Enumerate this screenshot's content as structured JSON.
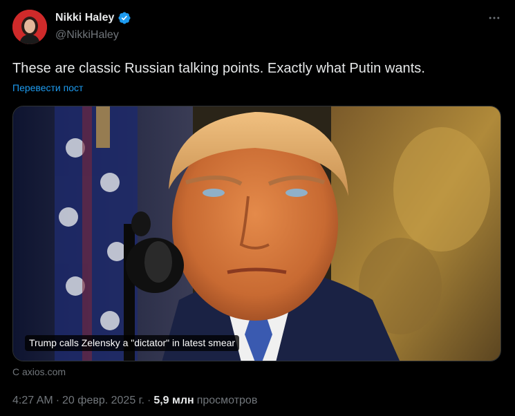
{
  "author": {
    "name": "Nikki Haley",
    "handle": "@NikkiHaley",
    "verified": true,
    "avatar_background": "#cf2a2a"
  },
  "header": {
    "more_icon": "more-horizontal-icon"
  },
  "tweet": {
    "text": "These are classic Russian talking points. Exactly what Putin wants.",
    "translate_label": "Перевести пост"
  },
  "card": {
    "caption": "Trump calls Zelensky a \"dictator\" in latest smear",
    "source": "С axios.com"
  },
  "meta": {
    "time": "4:27 AM",
    "separator": "·",
    "date": "20 февр. 2025 г.",
    "views_count": "5,9 млн",
    "views_label": "просмотров"
  },
  "colors": {
    "background": "#000000",
    "primary_text": "#e7e9ea",
    "secondary_text": "#71767b",
    "link": "#1d9bf0",
    "verified_badge": "#1d9bf0",
    "border": "#2f3336"
  }
}
